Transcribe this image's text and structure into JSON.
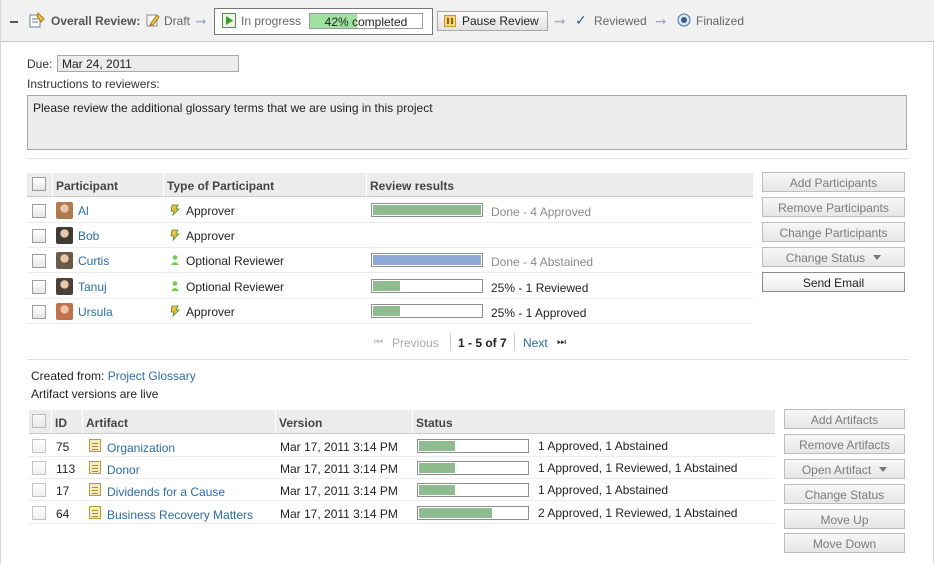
{
  "header": {
    "title": "Overall Review:",
    "steps": {
      "draft": "Draft",
      "in_progress": "In progress",
      "reviewed": "Reviewed",
      "finalized": "Finalized"
    },
    "progress": {
      "percent": 42,
      "label": "42% completed"
    },
    "pause_label": "Pause Review"
  },
  "due": {
    "label": "Due:",
    "value": "Mar 24, 2011"
  },
  "instructions": {
    "label": "Instructions to reviewers:",
    "text": "Please review the additional glossary terms that we are using in this project"
  },
  "participants": {
    "columns": [
      "Participant",
      "Type of Participant",
      "Review results"
    ],
    "rows": [
      {
        "name": "Al",
        "type": "Approver",
        "result": "Done - 4 Approved",
        "progress": 1.0,
        "done": true,
        "bar_color": "#8fbc8f"
      },
      {
        "name": "Bob",
        "type": "Approver",
        "result": "",
        "progress": 0,
        "done": false,
        "bar_color": "#8fbc8f"
      },
      {
        "name": "Curtis",
        "type": "Optional Reviewer",
        "result": "Done - 4 Abstained",
        "progress": 1.0,
        "done": true,
        "bar_color": "#8fa8d8"
      },
      {
        "name": "Tanuj",
        "type": "Optional Reviewer",
        "result": "25% - 1 Reviewed",
        "progress": 0.25,
        "done": false,
        "bar_color": "#8fbc8f"
      },
      {
        "name": "Ursula",
        "type": "Approver",
        "result": "25% - 1 Approved",
        "progress": 0.25,
        "done": false,
        "bar_color": "#8fbc8f"
      }
    ],
    "pagination": {
      "previous": "Previous",
      "range": "1 - 5 of 7",
      "next": "Next"
    },
    "buttons": {
      "add": "Add Participants",
      "remove": "Remove Participants",
      "change": "Change Participants",
      "change_status": "Change Status",
      "send_email": "Send Email"
    }
  },
  "created_from": {
    "label": "Created from:",
    "link": "Project Glossary",
    "note": "Artifact versions are live"
  },
  "artifacts": {
    "columns": [
      "ID",
      "Artifact",
      "Version",
      "Status"
    ],
    "rows": [
      {
        "id": "75",
        "name": "Organization",
        "version": "Mar 17, 2011 3:14 PM",
        "status": "1 Approved, 1 Abstained",
        "progress": 0.33
      },
      {
        "id": "113",
        "name": "Donor",
        "version": "Mar 17, 2011 3:14 PM",
        "status": "1 Approved, 1 Reviewed, 1 Abstained",
        "progress": 0.33
      },
      {
        "id": "17",
        "name": "Dividends for a Cause",
        "version": "Mar 17, 2011 3:14 PM",
        "status": "1 Approved, 1 Abstained",
        "progress": 0.33
      },
      {
        "id": "64",
        "name": "Business Recovery Matters",
        "version": "Mar 17, 2011 3:14 PM",
        "status": "2 Approved, 1 Reviewed, 1 Abstained",
        "progress": 0.66
      }
    ],
    "buttons": {
      "add": "Add Artifacts",
      "remove": "Remove Artifacts",
      "open": "Open Artifact",
      "change_status": "Change Status",
      "move_up": "Move Up",
      "move_down": "Move Down"
    }
  },
  "colors": {
    "link": "#2c6ca6",
    "progress_fill": "#9fe29f",
    "approved_bar": "#8fbc8f",
    "abstained_bar": "#8fa8d8"
  }
}
